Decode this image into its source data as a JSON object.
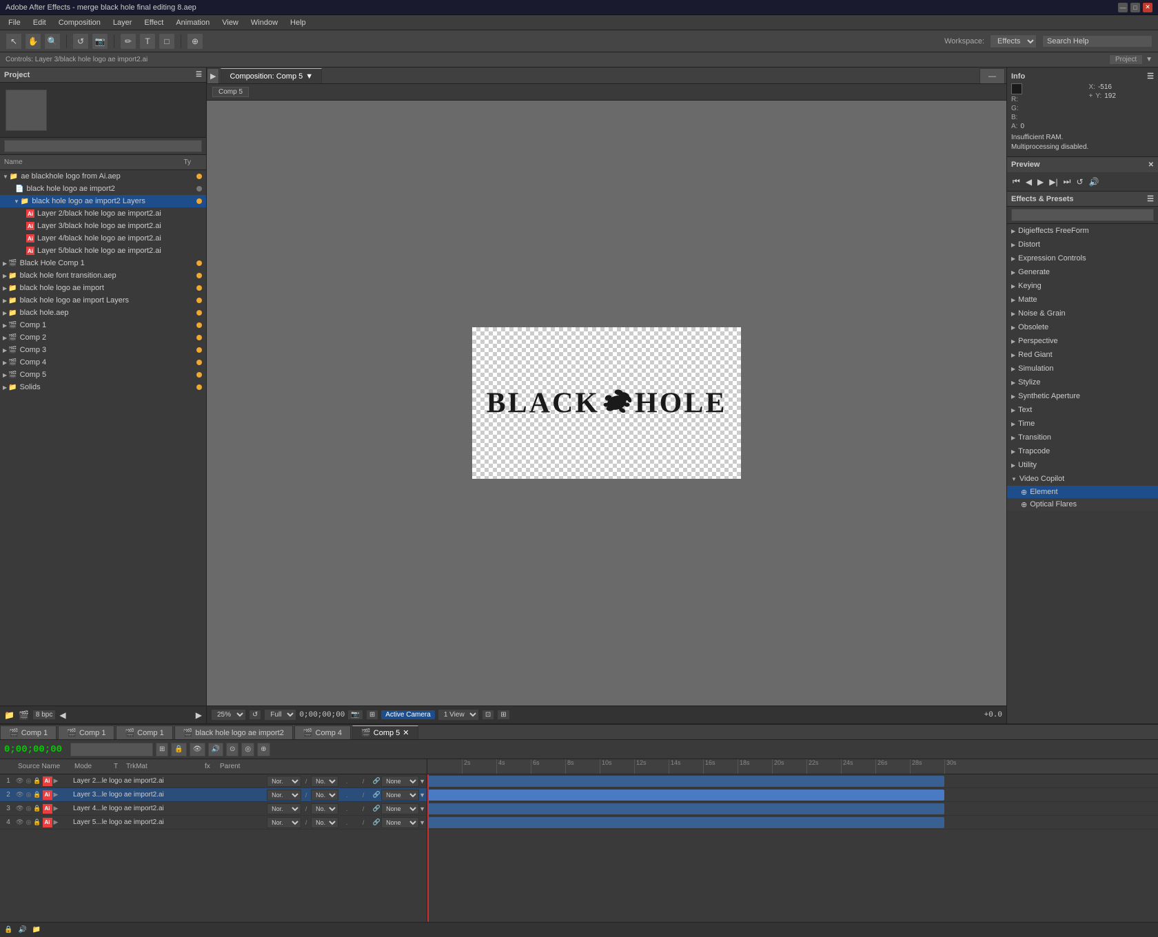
{
  "titlebar": {
    "title": "Adobe After Effects - merge black hole final editing 8.aep",
    "minimize_btn": "—",
    "maximize_btn": "□",
    "close_btn": "✕"
  },
  "menubar": {
    "items": [
      "File",
      "Edit",
      "Composition",
      "Layer",
      "Effect",
      "Animation",
      "View",
      "Window",
      "Help"
    ]
  },
  "toolbar": {
    "workspace_label": "Workspace:",
    "workspace_value": "Effects",
    "search_placeholder": "Search Help"
  },
  "controls_bar": {
    "text": "Controls: Layer 3/black hole logo ae import2.ai"
  },
  "project": {
    "panel_label": "Project",
    "search_placeholder": "",
    "columns": {
      "name": "Name",
      "type": "Ty"
    },
    "tree": [
      {
        "id": "ae-blackhole",
        "level": 0,
        "type": "folder",
        "label": "ae blackhole logo from Ai.aep",
        "dot": "yellow",
        "expanded": true
      },
      {
        "id": "black-hole-logo-ae",
        "level": 1,
        "type": "footage",
        "label": "black hole logo ae import2",
        "dot": "gray"
      },
      {
        "id": "black-hole-layers",
        "level": 1,
        "type": "folder",
        "label": "black hole logo ae import2 Layers",
        "dot": "yellow",
        "expanded": true,
        "selected": true
      },
      {
        "id": "layer2",
        "level": 2,
        "type": "ai",
        "label": "Layer 2/black hole logo ae import2.ai"
      },
      {
        "id": "layer3",
        "level": 2,
        "type": "ai",
        "label": "Layer 3/black hole logo ae import2.ai"
      },
      {
        "id": "layer4",
        "level": 2,
        "type": "ai",
        "label": "Layer 4/black hole logo ae import2.ai"
      },
      {
        "id": "layer5",
        "level": 2,
        "type": "ai",
        "label": "Layer 5/black hole logo ae import2.ai"
      },
      {
        "id": "black-hole-comp1",
        "level": 0,
        "type": "comp",
        "label": "Black Hole Comp 1",
        "dot": "yellow"
      },
      {
        "id": "black-hole-font",
        "level": 0,
        "type": "folder",
        "label": "black hole font transition.aep",
        "dot": "yellow"
      },
      {
        "id": "black-hole-import",
        "level": 0,
        "type": "folder",
        "label": "black hole logo ae import",
        "dot": "yellow"
      },
      {
        "id": "black-hole-import-layers",
        "level": 0,
        "type": "folder",
        "label": "black hole logo ae import Layers",
        "dot": "yellow"
      },
      {
        "id": "black-hole-aep",
        "level": 0,
        "type": "folder",
        "label": "black hole.aep",
        "dot": "yellow"
      },
      {
        "id": "comp1",
        "level": 0,
        "type": "comp",
        "label": "Comp 1",
        "dot": "yellow"
      },
      {
        "id": "comp2",
        "level": 0,
        "type": "comp",
        "label": "Comp 2",
        "dot": "yellow"
      },
      {
        "id": "comp3",
        "level": 0,
        "type": "comp",
        "label": "Comp 3",
        "dot": "yellow"
      },
      {
        "id": "comp4",
        "level": 0,
        "type": "comp",
        "label": "Comp 4",
        "dot": "yellow"
      },
      {
        "id": "comp5",
        "level": 0,
        "type": "comp",
        "label": "Comp 5",
        "dot": "yellow"
      },
      {
        "id": "solids",
        "level": 0,
        "type": "folder",
        "label": "Solids",
        "dot": "yellow"
      }
    ]
  },
  "composition": {
    "title": "Composition: Comp 5",
    "active_tab": "Comp 5",
    "zoom": "25%",
    "timecode": "0;00;00;00",
    "view_mode": "Full",
    "camera": "Active Camera",
    "view": "1 View",
    "fps": "+0.0",
    "black_hole_text": "BLACK HOLE"
  },
  "info": {
    "panel_label": "Info",
    "r_label": "R:",
    "g_label": "G:",
    "b_label": "B:",
    "a_label": "A:",
    "r_value": "",
    "g_value": "",
    "b_value": "",
    "a_value": "0",
    "x_label": "X:",
    "x_value": "-516",
    "y_label": "Y:",
    "y_value": "192",
    "warning": "Insufficient RAM.\nMultiprocessing disabled."
  },
  "preview": {
    "panel_label": "Preview",
    "controls": [
      "⏮",
      "◀",
      "▶",
      "⏭",
      "◀◀",
      "▶▶"
    ]
  },
  "effects_presets": {
    "panel_label": "Effects & Presets",
    "search_placeholder": "",
    "categories": [
      {
        "label": "Digieffects FreeForm",
        "expanded": false
      },
      {
        "label": "Distort",
        "expanded": false
      },
      {
        "label": "Expression Controls",
        "expanded": false
      },
      {
        "label": "Generate",
        "expanded": false
      },
      {
        "label": "Keying",
        "expanded": false
      },
      {
        "label": "Matte",
        "expanded": false
      },
      {
        "label": "Noise & Grain",
        "expanded": false
      },
      {
        "label": "Obsolete",
        "expanded": false
      },
      {
        "label": "Perspective",
        "expanded": false
      },
      {
        "label": "Red Giant",
        "expanded": false
      },
      {
        "label": "Simulation",
        "expanded": false
      },
      {
        "label": "Stylize",
        "expanded": false
      },
      {
        "label": "Synthetic Aperture",
        "expanded": false
      },
      {
        "label": "Text",
        "expanded": false
      },
      {
        "label": "Time",
        "expanded": false
      },
      {
        "label": "Transition",
        "expanded": false
      },
      {
        "label": "Trapcode",
        "expanded": false
      },
      {
        "label": "Utility",
        "expanded": false
      },
      {
        "label": "Video Copilot",
        "expanded": true
      }
    ],
    "video_copilot_items": [
      {
        "label": "Element",
        "highlighted": true
      },
      {
        "label": "Optical Flares",
        "highlighted": false
      }
    ]
  },
  "timeline": {
    "tabs": [
      {
        "label": "Comp 1",
        "active": false
      },
      {
        "label": "Comp 1",
        "active": false
      },
      {
        "label": "Comp 1",
        "active": false
      },
      {
        "label": "black hole logo ae import2",
        "active": false
      },
      {
        "label": "Comp 4",
        "active": false
      },
      {
        "label": "Comp 5",
        "active": true
      }
    ],
    "timecode": "0;00;00;00",
    "layers": [
      {
        "num": "1",
        "name": "Layer 2...le logo ae import2.ai",
        "mode": "Nor.",
        "parent": "None",
        "selected": false
      },
      {
        "num": "2",
        "name": "Layer 3...le logo ae import2.ai",
        "mode": "Nor.",
        "parent": "None",
        "selected": true
      },
      {
        "num": "3",
        "name": "Layer 4...le logo ae import2.ai",
        "mode": "Nor.",
        "parent": "None",
        "selected": false
      },
      {
        "num": "4",
        "name": "Layer 5...le logo ae import2.ai",
        "mode": "Nor.",
        "parent": "None",
        "selected": false
      }
    ],
    "ruler_marks": [
      "2s",
      "4s",
      "6s",
      "8s",
      "10s",
      "12s",
      "14s",
      "16s",
      "18s",
      "20s",
      "22s",
      "24s",
      "26s",
      "28s",
      "30s"
    ],
    "ruler_positions": [
      50,
      100,
      150,
      200,
      250,
      300,
      350,
      400,
      450,
      500,
      550,
      600,
      650,
      700,
      750
    ],
    "header_cols": [
      "Source Name",
      "Mode",
      "T",
      "TrkMat",
      "",
      "",
      "fx",
      "Parent"
    ]
  },
  "bottom_status": {
    "items": [
      "🔒",
      "🔊",
      "📁"
    ]
  }
}
